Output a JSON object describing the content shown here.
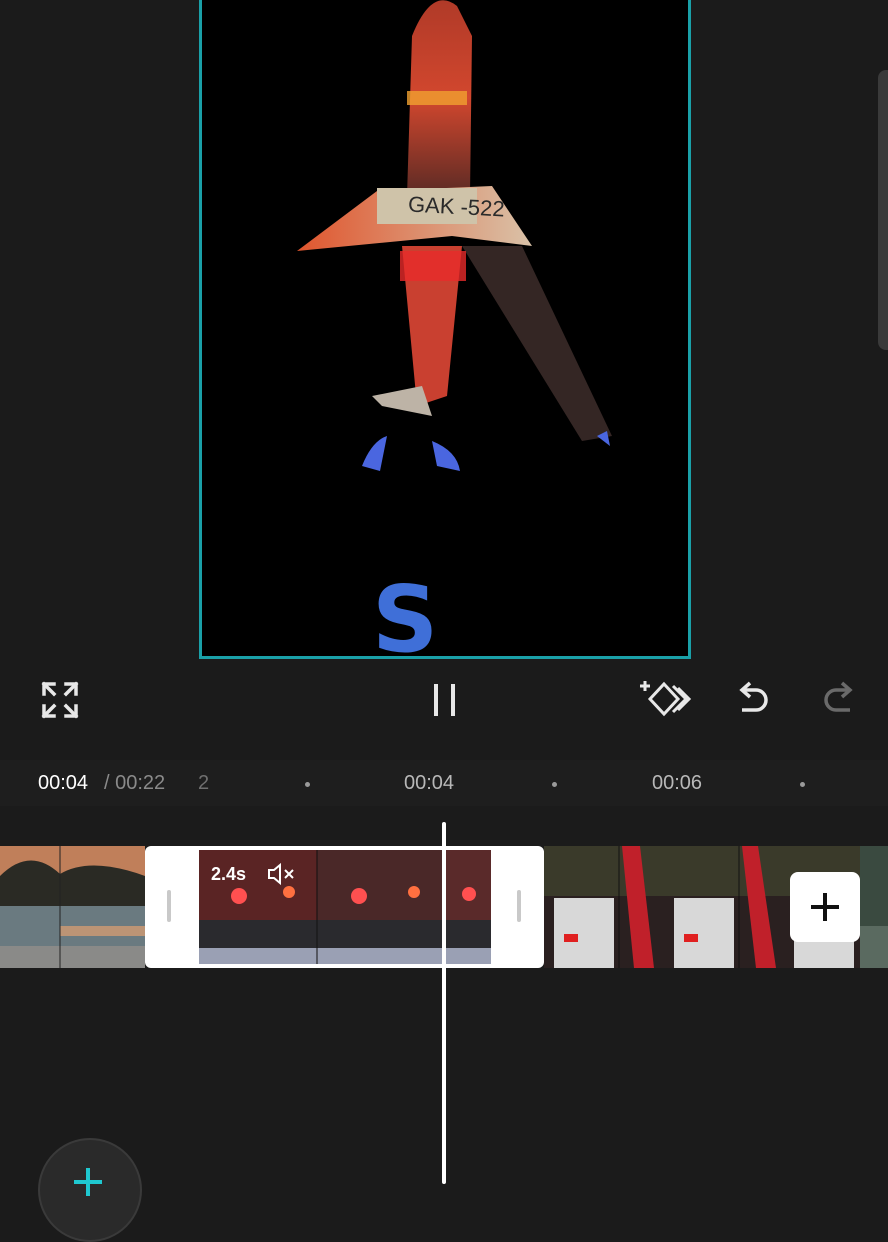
{
  "timeline": {
    "current_time": "00:04",
    "total_time": "/ 00:22",
    "ruler_labels": [
      "2",
      "00:04",
      "00:06"
    ],
    "selected_clip": {
      "duration": "2.4s"
    }
  },
  "preview": {
    "plate_text": "GAK -522",
    "overlay_letter": "S"
  },
  "icons": {
    "fullscreen": "fullscreen-icon",
    "pause": "pause-icon",
    "keyframe": "keyframe-add-icon",
    "undo": "undo-icon",
    "redo": "redo-icon",
    "mute": "mute-icon",
    "add": "plus-icon"
  },
  "colors": {
    "accent": "#1aa0a8",
    "background": "#1b1b1b"
  }
}
